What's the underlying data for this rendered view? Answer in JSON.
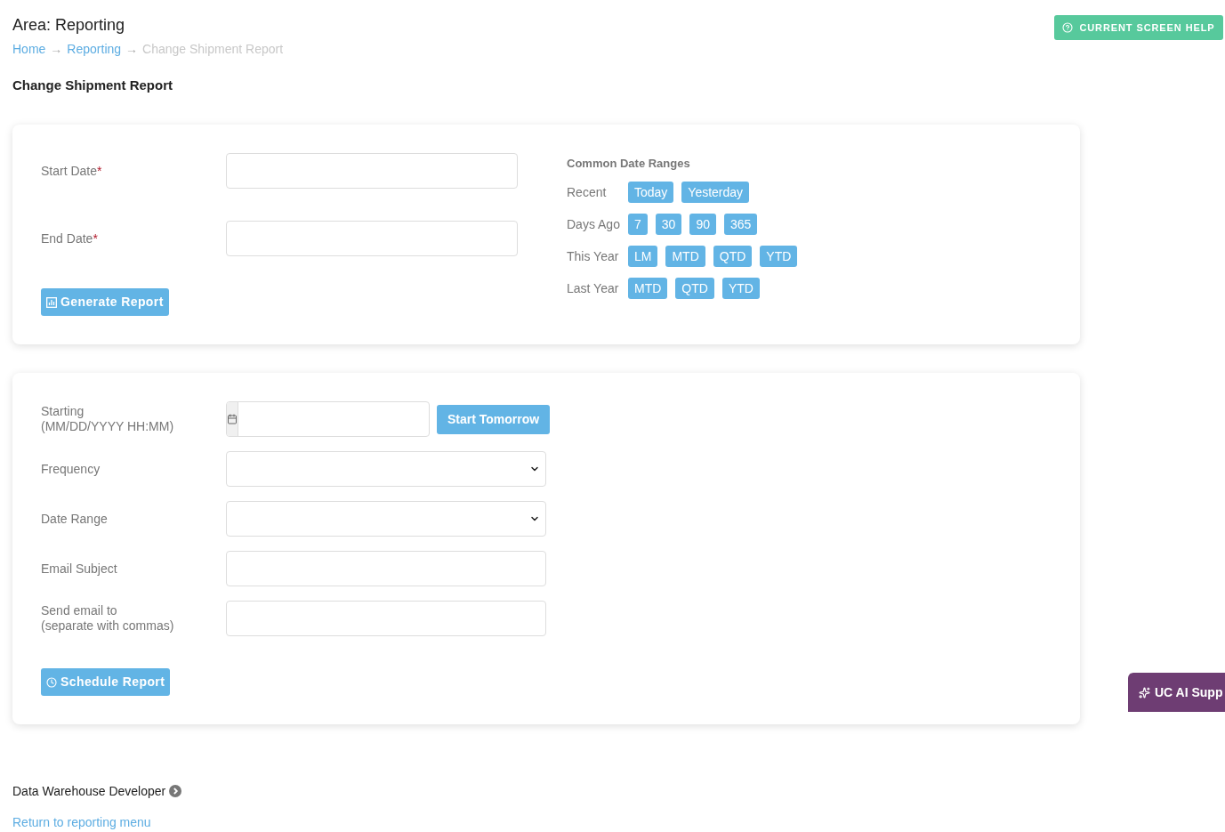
{
  "header": {
    "area_title": "Area: Reporting",
    "help_button": "CURRENT SCREEN HELP"
  },
  "breadcrumb": [
    {
      "label": "Home",
      "kind": "link",
      "separator": "→"
    },
    {
      "label": "Reporting",
      "kind": "link",
      "separator": "→"
    },
    {
      "label": "Change Shipment Report",
      "kind": "current"
    }
  ],
  "page_title": "Change Shipment Report",
  "report_form": {
    "fields": [
      {
        "label": "Start Date",
        "required_mark": "*"
      },
      {
        "label": "End Date",
        "required_mark": "*"
      }
    ],
    "generate_button": "Generate Report"
  },
  "date_ranges": {
    "title": "Common Date Ranges",
    "groups": [
      {
        "label": "Recent",
        "buttons": [
          "Today",
          "Yesterday"
        ]
      },
      {
        "label": "Days Ago",
        "buttons": [
          "7",
          "30",
          "90",
          "365"
        ]
      },
      {
        "label": "This Year",
        "buttons": [
          "LM",
          "MTD",
          "QTD",
          "YTD"
        ]
      },
      {
        "label": "Last Year",
        "buttons": [
          "MTD",
          "QTD",
          "YTD"
        ]
      }
    ]
  },
  "schedule_form": {
    "fields": [
      {
        "kind": "date",
        "label": "Starting",
        "hint": "(MM/DD/YYYY HH:MM)",
        "button": "Start Tomorrow"
      },
      {
        "kind": "select",
        "label": "Frequency"
      },
      {
        "kind": "select",
        "label": "Date Range"
      },
      {
        "kind": "text",
        "label": "Email Subject"
      },
      {
        "kind": "text",
        "label": "Send email to",
        "hint": "(separate with commas)"
      }
    ],
    "schedule_button": "Schedule Report"
  },
  "footer": {
    "role": "Data Warehouse Developer",
    "return_link": "Return to reporting menu"
  },
  "ai_support": {
    "label": "UC AI Supp"
  }
}
